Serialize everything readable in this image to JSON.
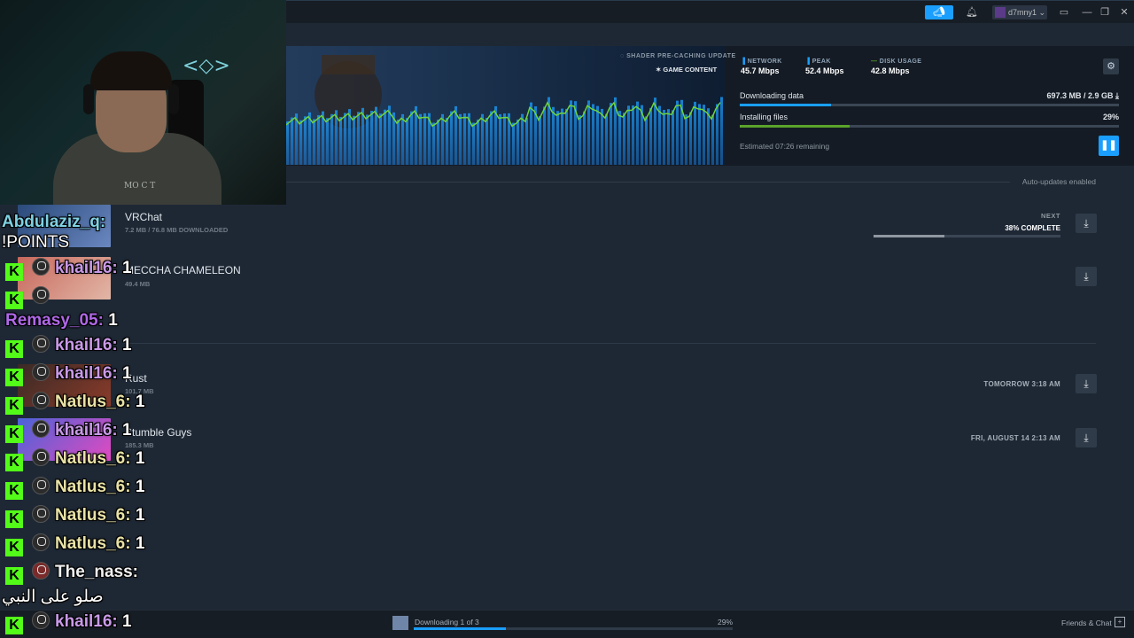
{
  "titlebar": {
    "username": "d7mny1"
  },
  "hero": {
    "shader_label": "SHADER PRE-CACHING UPDATE",
    "shader_sub": "GAME CONTENT",
    "network_label": "NETWORK",
    "network_value": "45.7 Mbps",
    "peak_label": "PEAK",
    "peak_value": "52.4 Mbps",
    "disk_label": "DISK USAGE",
    "disk_value": "42.8 Mbps",
    "downloading_label": "Downloading data",
    "downloading_value": "697.3 MB / 2.9 GB",
    "downloading_fraction": 0.24,
    "installing_label": "Installing files",
    "installing_value": "29%",
    "installing_fraction": 0.29,
    "estimated": "Estimated 07:26 remaining"
  },
  "list": {
    "auto_updates": "Auto-updates enabled",
    "items": [
      {
        "title": "VRChat",
        "sub": "7.2 MB / 76.8 MB DOWNLOADED",
        "next_label": "NEXT",
        "complete": "38% COMPLETE"
      },
      {
        "title": "MECCHA CHAMELEON",
        "sub": "49.4 MB"
      },
      {
        "title": "Rust",
        "sub": "101.7 MB",
        "schedule": "TOMORROW 3:18 AM"
      },
      {
        "title": "Stumble Guys",
        "sub": "185.3 MB",
        "schedule": "FRI, AUGUST 14 2:13 AM"
      }
    ]
  },
  "bottom": {
    "downloading": "Downloading 1 of 3",
    "percent": "29%",
    "friends": "Friends & Chat"
  },
  "chat": [
    {
      "user": "Abdulaziz_q:",
      "text": ""
    },
    {
      "user": "",
      "text": "!POINTS"
    },
    {
      "user": "khail16:",
      "text": "1"
    },
    {
      "user": "Remasy_05:",
      "text": "1"
    },
    {
      "user": "khail16:",
      "text": "1"
    },
    {
      "user": "khail16:",
      "text": "1"
    },
    {
      "user": "Natlus_6:",
      "text": "1"
    },
    {
      "user": "khail16:",
      "text": "1"
    },
    {
      "user": "Natlus_6:",
      "text": "1"
    },
    {
      "user": "Natlus_6:",
      "text": "1"
    },
    {
      "user": "Natlus_6:",
      "text": "1"
    },
    {
      "user": "Natlus_6:",
      "text": "1"
    },
    {
      "user": "The_nass:",
      "text": ""
    },
    {
      "user": "",
      "text": "صلو على النبي"
    },
    {
      "user": "khail16:",
      "text": "1"
    }
  ],
  "webcam": {
    "logo": "<◇>",
    "poster": "MO C T"
  },
  "icons": {
    "announce": "megaphone-icon",
    "bell": "bell-icon",
    "settings": "gear-icon",
    "pause": "pause-icon",
    "download": "download-icon"
  }
}
